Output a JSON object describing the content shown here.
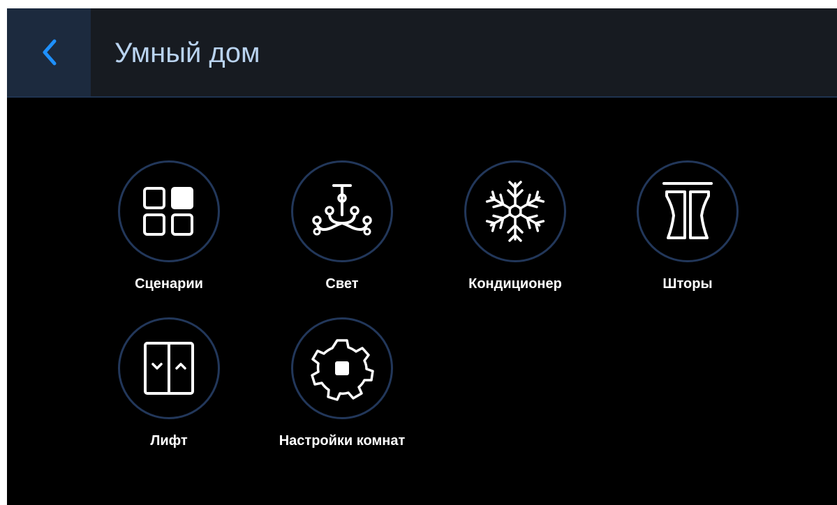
{
  "header": {
    "title": "Умный дом",
    "back_icon": "chevron-left-icon",
    "accent": "#1e90ff"
  },
  "tiles": [
    {
      "label": "Сценарии",
      "icon": "scenes-grid-icon"
    },
    {
      "label": "Свет",
      "icon": "chandelier-icon"
    },
    {
      "label": "Кондиционер",
      "icon": "snowflake-icon"
    },
    {
      "label": "Шторы",
      "icon": "curtains-icon"
    },
    {
      "label": "Лифт",
      "icon": "elevator-icon"
    },
    {
      "label": "Настройки комнат",
      "icon": "gear-icon"
    }
  ],
  "colors": {
    "background": "#000000",
    "header_background": "#171b21",
    "back_button_background": "#1c2a3e",
    "title_color": "#b9d3ef",
    "circle_border": "#22375a",
    "icon_color": "#ffffff"
  }
}
